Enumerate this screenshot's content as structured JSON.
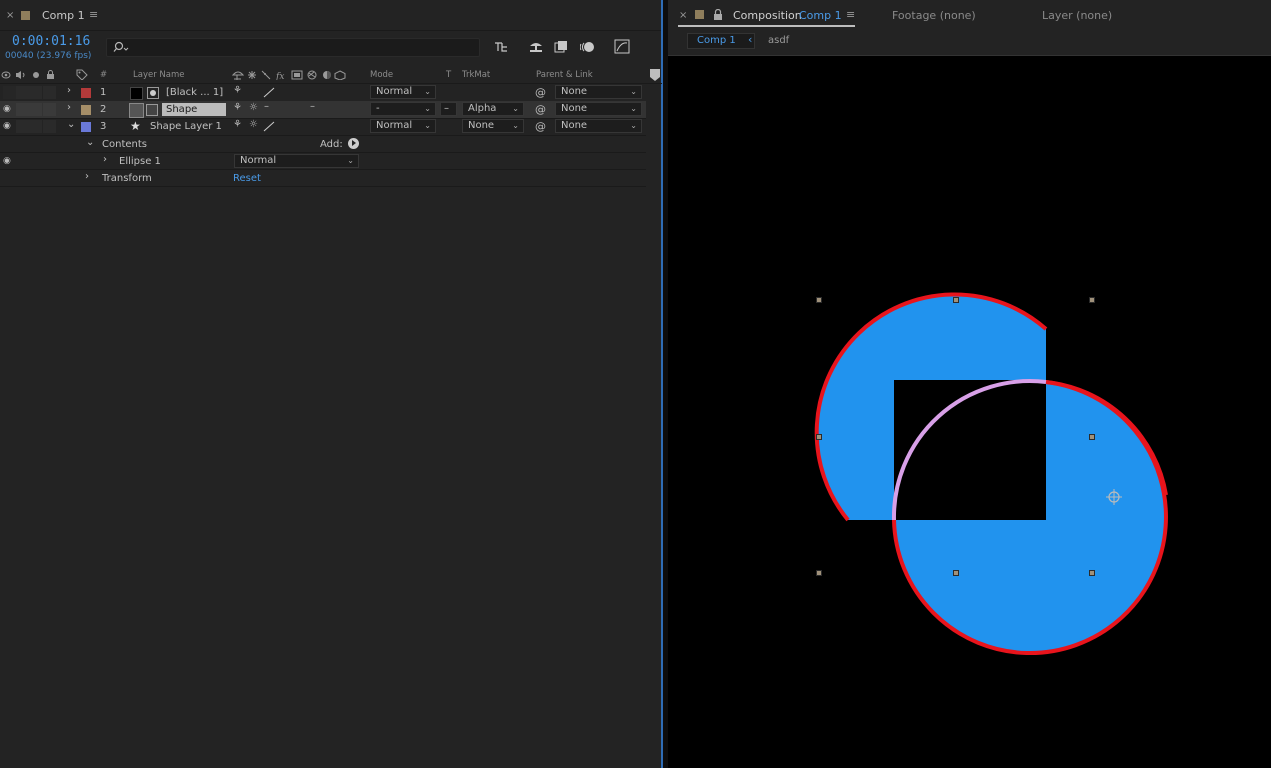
{
  "timeline_panel": {
    "close": "×",
    "tab_title": "Comp 1",
    "menu": "≡",
    "timecode": "0:00:01:16",
    "frame_info": "00040 (23.976 fps)",
    "search_placeholder": "",
    "label_color": "#8f7e5c"
  },
  "columns": {
    "number": "#",
    "layer_name": "Layer Name",
    "mode": "Mode",
    "t": "T",
    "trkmat": "TrkMat",
    "parent": "Parent & Link"
  },
  "layers": [
    {
      "num": "1",
      "name": "[Black ... 1]",
      "color": "#b43a3a",
      "mode": "Normal",
      "trkmat": "",
      "parent": "None"
    },
    {
      "num": "2",
      "name": "Shape",
      "color": "#a58e68",
      "mode": "-",
      "trkmat": "Alpha",
      "parent": "None"
    },
    {
      "num": "3",
      "name": "Shape Layer 1",
      "color": "#6a79d8",
      "mode": "Normal",
      "trkmat": "None",
      "parent": "None"
    }
  ],
  "contents": {
    "label": "Contents",
    "add_label": "Add:",
    "ellipse_label": "Ellipse 1",
    "ellipse_mode": "Normal",
    "transform_label": "Transform",
    "reset_label": "Reset"
  },
  "composition_panel": {
    "close": "×",
    "tab_prefix": "Composition",
    "tab_comp": "Comp 1",
    "menu": "≡",
    "footage_tab": "Footage  (none)",
    "layer_tab": "Layer  (none)",
    "crumb_active": "Comp 1",
    "crumb_other": "asdf"
  },
  "colors": {
    "accent_blue": "#4a9be8",
    "shape_fill": "#2193ee",
    "stroke_red": "#e8141c",
    "stroke_purple": "#d8a0e8"
  }
}
